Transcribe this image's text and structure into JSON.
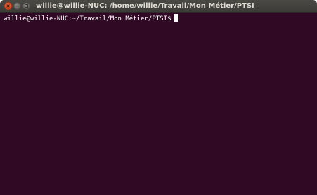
{
  "window": {
    "title": "willie@willie-NUC: /home/willie/Travail/Mon Métier/PTSI",
    "buttons": [
      "close-icon",
      "minimize-icon",
      "maximize-icon"
    ]
  },
  "terminal": {
    "prompt": "willie@willie-NUC:~/Travail/Mon Métier/PTSI$",
    "input": "",
    "colors": {
      "background": "#300a24",
      "foreground": "#ffffff",
      "close_button": "#e1471f"
    }
  }
}
